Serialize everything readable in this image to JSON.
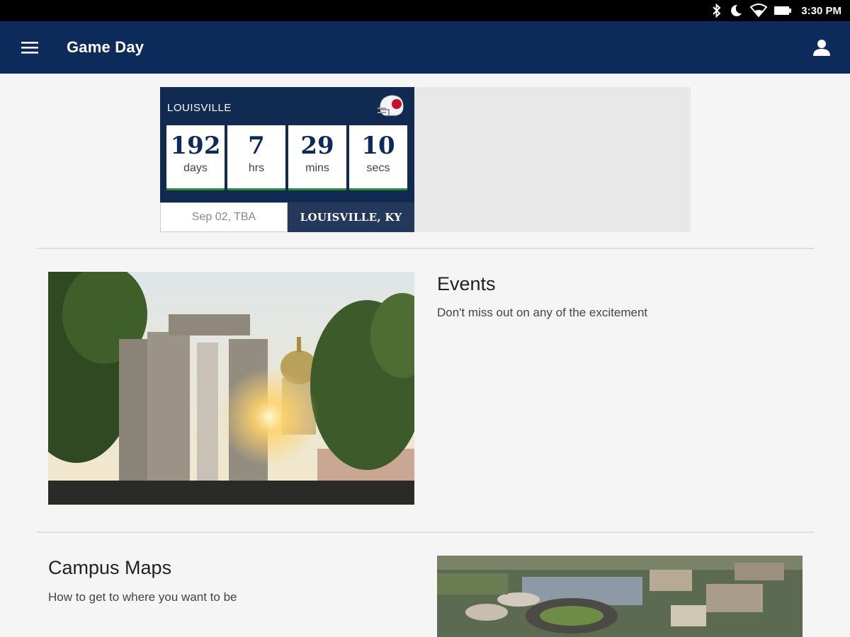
{
  "status_bar": {
    "time": "3:30 PM",
    "icons": [
      "bluetooth-icon",
      "moon-icon",
      "wifi-icon",
      "battery-icon"
    ]
  },
  "app_bar": {
    "title": "Game Day",
    "menu_icon": "hamburger-menu-icon",
    "profile_icon": "person-icon",
    "color": "#0c2a5a"
  },
  "countdown": {
    "opponent": "LOUISVILLE",
    "helmet_icon": "football-helmet-icon",
    "units": [
      {
        "value": "192",
        "label": "days"
      },
      {
        "value": "7",
        "label": "hrs"
      },
      {
        "value": "29",
        "label": "mins"
      },
      {
        "value": "10",
        "label": "secs"
      }
    ],
    "date": "Sep 02, TBA",
    "location": "LOUISVILLE, KY",
    "accent_color": "#2e8b3a"
  },
  "sections": {
    "events": {
      "title": "Events",
      "subtitle": "Don't miss out on any of the excitement"
    },
    "campus_maps": {
      "title": "Campus Maps",
      "subtitle": "How to get to where you want to be"
    }
  }
}
